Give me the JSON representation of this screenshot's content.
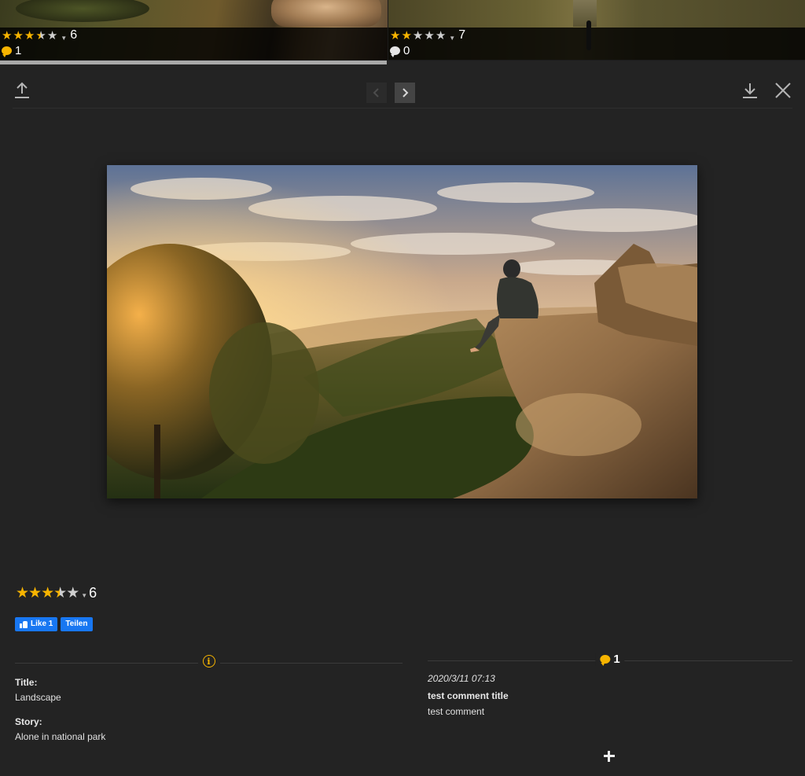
{
  "thumbnails": [
    {
      "rating": 3.5,
      "stars": [
        "full",
        "full",
        "full",
        "half",
        "empty"
      ],
      "rating_count": "6",
      "comment_count": "1",
      "comment_icon": "speech-bubble-yellow"
    },
    {
      "rating": 2,
      "stars": [
        "full",
        "full",
        "empty",
        "empty",
        "empty"
      ],
      "rating_count": "7",
      "comment_count": "0",
      "comment_icon": "speech-bubble-white"
    }
  ],
  "slideshow": {
    "progress": 0.48
  },
  "toolbar": {
    "share_icon": "share-upload-icon",
    "prev_icon": "chevron-left-icon",
    "next_icon": "chevron-right-icon",
    "download_icon": "download-icon",
    "close_icon": "close-icon"
  },
  "image": {
    "subject": "hooded person sitting on rock ledge above forest valley at sunrise"
  },
  "rating": {
    "value": 3.5,
    "stars": [
      "full",
      "full",
      "full",
      "half",
      "empty"
    ],
    "count": "6"
  },
  "social": {
    "like_label": "Like 1",
    "share_label": "Teilen"
  },
  "info": {
    "title_label": "Title:",
    "title_value": "Landscape",
    "story_label": "Story:",
    "story_value": "Alone in national park"
  },
  "comments": {
    "count": "1",
    "items": [
      {
        "date": "2020/3/11 07:13",
        "title": "test comment title",
        "text": "test comment"
      }
    ]
  },
  "colors": {
    "background": "#232323",
    "accent": "#f7b400",
    "facebook": "#1877f2"
  }
}
